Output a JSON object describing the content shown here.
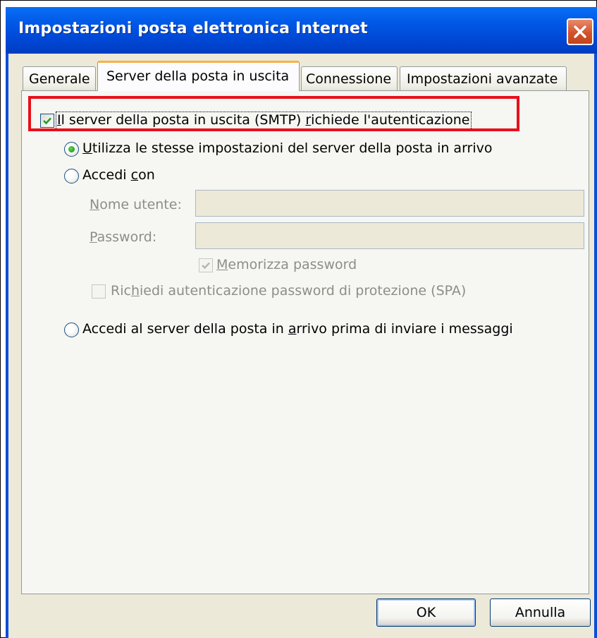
{
  "window": {
    "title": "Impostazioni posta elettronica Internet"
  },
  "tabs": [
    {
      "label": "Generale",
      "active": false
    },
    {
      "label": "Server della posta in uscita",
      "active": true
    },
    {
      "label": "Connessione",
      "active": false
    },
    {
      "label": "Impostazioni avanzate",
      "active": false
    }
  ],
  "smtp_auth": {
    "label_pre": "",
    "label_u": "I",
    "label_post": "l server della posta in uscita (SMTP) ",
    "label_u2": "r",
    "label_post2": "ichiede l'autenticazione",
    "checked": true
  },
  "radio_same": {
    "label_u": "U",
    "label_post": "tilizza le stesse impostazioni del server della posta in arrivo",
    "selected": true
  },
  "radio_login": {
    "label_pre": "Accedi ",
    "label_u": "c",
    "label_post": "on",
    "selected": false
  },
  "username": {
    "label_u": "N",
    "label_post": "ome utente:",
    "value": ""
  },
  "password": {
    "label_u": "P",
    "label_post": "assword:",
    "value": ""
  },
  "remember_password": {
    "label_u": "M",
    "label_post": "emorizza password",
    "checked": true,
    "enabled": false
  },
  "spa": {
    "label_pre": "Ric",
    "label_u": "h",
    "label_post": "iedi autenticazione password di protezione (SPA)",
    "checked": false,
    "enabled": false
  },
  "radio_incoming_first": {
    "label_pre": "Accedi al server della posta in ",
    "label_u": "a",
    "label_post": "rrivo prima di inviare i messaggi",
    "selected": false
  },
  "buttons": {
    "ok": "OK",
    "cancel": "Annulla"
  },
  "colors": {
    "title_bar": "#0058e6",
    "highlight_box": "#e8101a",
    "dialog_bg": "#ece9d8",
    "active_tab_accent": "#f7b146"
  },
  "icons": {
    "close": "close-icon",
    "check": "check-icon"
  }
}
